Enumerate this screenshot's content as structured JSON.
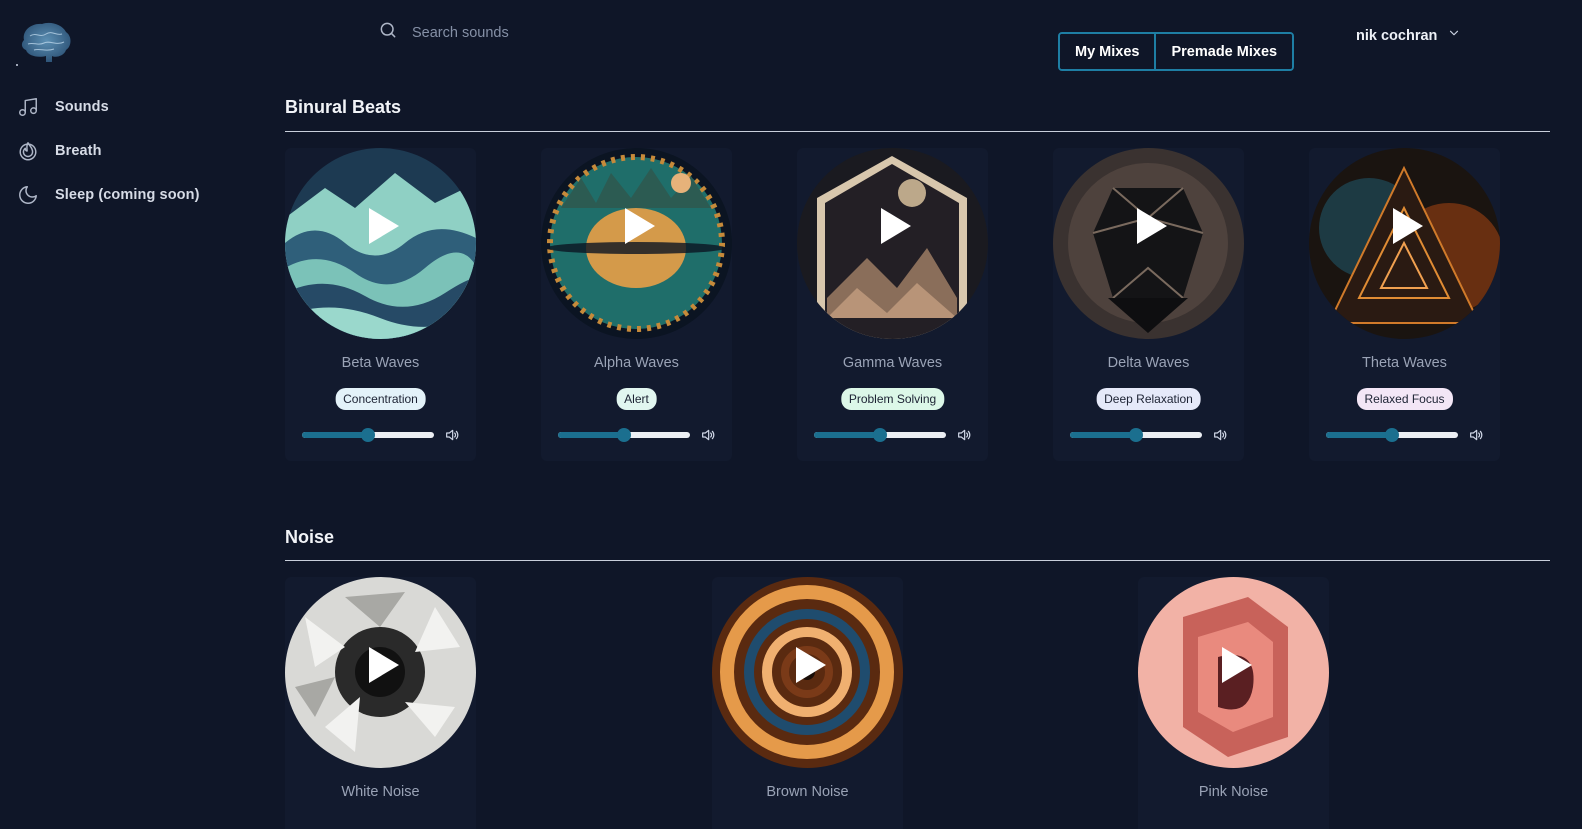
{
  "sidebar": {
    "items": [
      {
        "label": "Sounds",
        "icon": "music-note-icon"
      },
      {
        "label": "Breath",
        "icon": "flame-icon"
      },
      {
        "label": "Sleep (coming soon)",
        "icon": "moon-icon"
      }
    ]
  },
  "search": {
    "placeholder": "Search sounds"
  },
  "mixes": {
    "my_label": "My Mixes",
    "premade_label": "Premade Mixes"
  },
  "user": {
    "name": "nik cochran"
  },
  "sections": {
    "binural": {
      "title": "Binural Beats",
      "cards": [
        {
          "title": "Beta Waves",
          "tag": "Concentration",
          "tag_color": "#e3f2f9",
          "volume": 0.5
        },
        {
          "title": "Alpha Waves",
          "tag": "Alert",
          "tag_color": "#e1f6f0",
          "volume": 0.5
        },
        {
          "title": "Gamma Waves",
          "tag": "Problem Solving",
          "tag_color": "#dcf7e8",
          "volume": 0.5
        },
        {
          "title": "Delta Waves",
          "tag": "Deep Relaxation",
          "tag_color": "#e5e9f9",
          "volume": 0.5
        },
        {
          "title": "Theta Waves",
          "tag": "Relaxed Focus",
          "tag_color": "#f3e6f6",
          "volume": 0.5
        }
      ]
    },
    "noise": {
      "title": "Noise",
      "cards": [
        {
          "title": "White Noise"
        },
        {
          "title": "Brown Noise"
        },
        {
          "title": "Pink Noise"
        }
      ]
    }
  },
  "colors": {
    "background": "#0f1628",
    "accent": "#1b6f8f",
    "toggle_border": "#1e7ea4"
  }
}
